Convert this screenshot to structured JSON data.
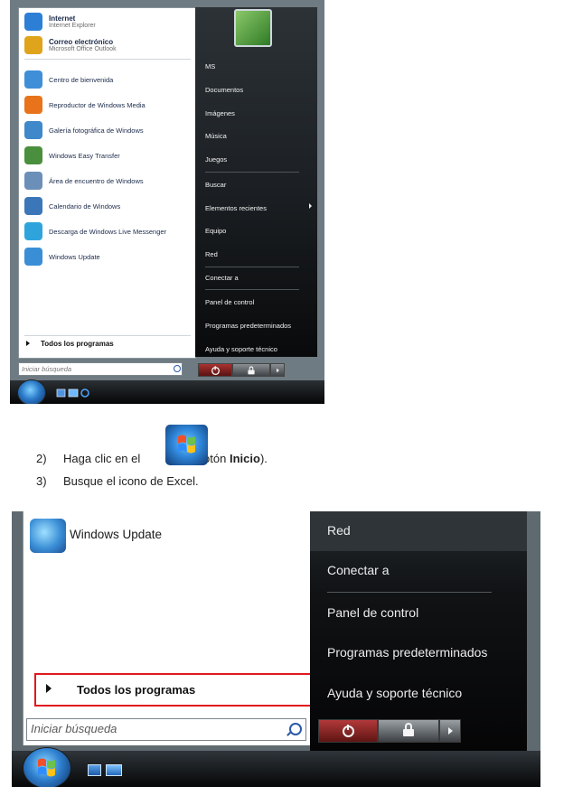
{
  "shot1": {
    "pinned": [
      {
        "title": "Internet",
        "subtitle": "Internet Explorer",
        "color": "#2d7fd6"
      },
      {
        "title": "Correo electrónico",
        "subtitle": "Microsoft Office Outlook",
        "color": "#e0a41c"
      }
    ],
    "recent": [
      {
        "label": "Centro de bienvenida",
        "color": "#3f8fd8"
      },
      {
        "label": "Reproductor de Windows Media",
        "color": "#e8731a"
      },
      {
        "label": "Galería fotográfica de Windows",
        "color": "#3f88c9"
      },
      {
        "label": "Windows Easy Transfer",
        "color": "#4a8f3d"
      },
      {
        "label": "Área de encuentro de Windows",
        "color": "#6b8fb8"
      },
      {
        "label": "Calendario de Windows",
        "color": "#3b77b8"
      },
      {
        "label": "Descarga de Windows Live Messenger",
        "color": "#2fa4dc"
      },
      {
        "label": "Windows Update",
        "color": "#3a8ed6"
      }
    ],
    "all_programs": "Todos los programas",
    "search_placeholder": "Iniciar búsqueda",
    "right": [
      "MS",
      "Documentos",
      "Imágenes",
      "Música",
      "Juegos",
      "Buscar",
      "Elementos recientes",
      "Equipo",
      "Red",
      "Conectar a",
      "Panel de control",
      "Programas predeterminados",
      "Ayuda y soporte técnico"
    ]
  },
  "steps": {
    "step2_num": "2)",
    "step2_pre": "Haga clic en el ",
    "step2_open": " (botón ",
    "step2_bold": "Inicio",
    "step2_close": ").",
    "step3_num": "3)",
    "step3": "Busque el icono de Excel."
  },
  "shot2": {
    "windows_update": "Windows Update",
    "all_programs": "Todos los programas",
    "search_placeholder": "Iniciar búsqueda",
    "right": [
      "Red",
      "Conectar a",
      "Panel de control",
      "Programas predeterminados",
      "Ayuda y soporte técnico"
    ],
    "highlight_color": "#e0191d"
  }
}
